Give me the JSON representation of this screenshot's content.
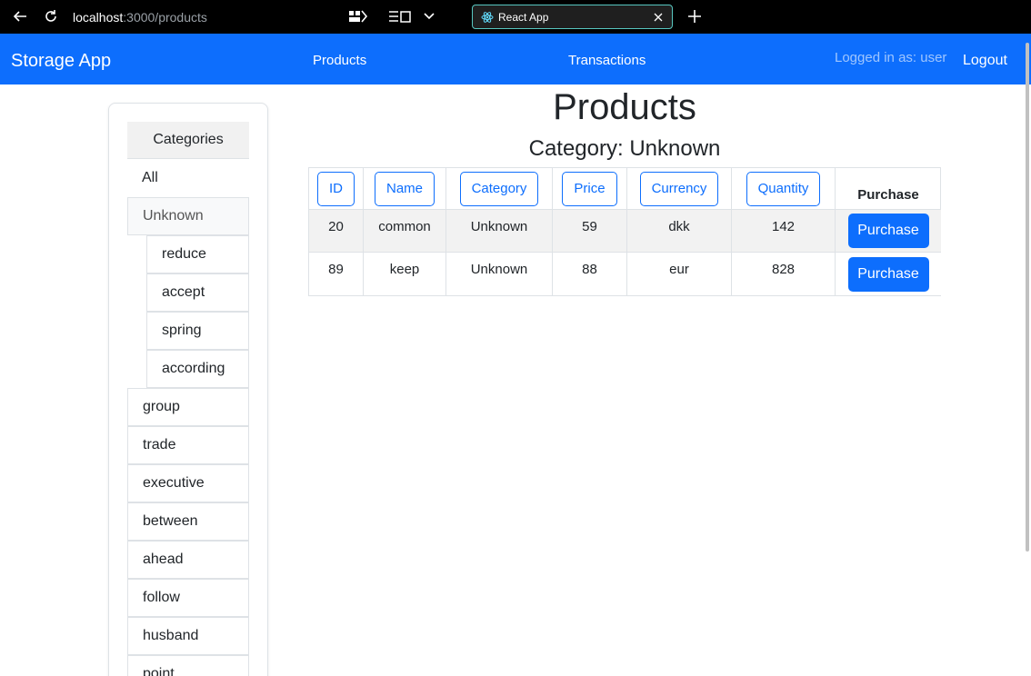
{
  "browser": {
    "url_host": "localhost",
    "url_rest": ":3000/products",
    "tab_title": "React App"
  },
  "navbar": {
    "brand": "Storage App",
    "links": [
      "Products",
      "Transactions"
    ],
    "status": "Logged in as: user",
    "logout": "Logout"
  },
  "sidebar": {
    "header": "Categories",
    "items": [
      {
        "label": "All",
        "level": 0,
        "state": "plain"
      },
      {
        "label": "Unknown",
        "level": 0,
        "state": "active"
      },
      {
        "label": "reduce",
        "level": 1,
        "state": "normal"
      },
      {
        "label": "accept",
        "level": 1,
        "state": "normal"
      },
      {
        "label": "spring",
        "level": 1,
        "state": "normal"
      },
      {
        "label": "according",
        "level": 1,
        "state": "normal"
      },
      {
        "label": "group",
        "level": 0,
        "state": "normal"
      },
      {
        "label": "trade",
        "level": 0,
        "state": "normal"
      },
      {
        "label": "executive",
        "level": 0,
        "state": "normal"
      },
      {
        "label": "between",
        "level": 0,
        "state": "normal"
      },
      {
        "label": "ahead",
        "level": 0,
        "state": "normal"
      },
      {
        "label": "follow",
        "level": 0,
        "state": "normal"
      },
      {
        "label": "husband",
        "level": 0,
        "state": "normal"
      },
      {
        "label": "point",
        "level": 0,
        "state": "normal"
      }
    ]
  },
  "main": {
    "title": "Products",
    "subtitle": "Category: Unknown",
    "table": {
      "sort_headers": [
        "ID",
        "Name",
        "Category",
        "Price",
        "Currency",
        "Quantity"
      ],
      "purchase_header": "Purchase",
      "rows": [
        {
          "id": "20",
          "name": "common",
          "category": "Unknown",
          "price": "59",
          "currency": "dkk",
          "quantity": "142",
          "action": "Purchase"
        },
        {
          "id": "89",
          "name": "keep",
          "category": "Unknown",
          "price": "88",
          "currency": "eur",
          "quantity": "828",
          "action": "Purchase"
        }
      ]
    }
  },
  "colors": {
    "primary": "#0d6efd",
    "chrome": "#000000",
    "tab_border": "#58c7c0",
    "stripe": "#f2f2f2"
  }
}
